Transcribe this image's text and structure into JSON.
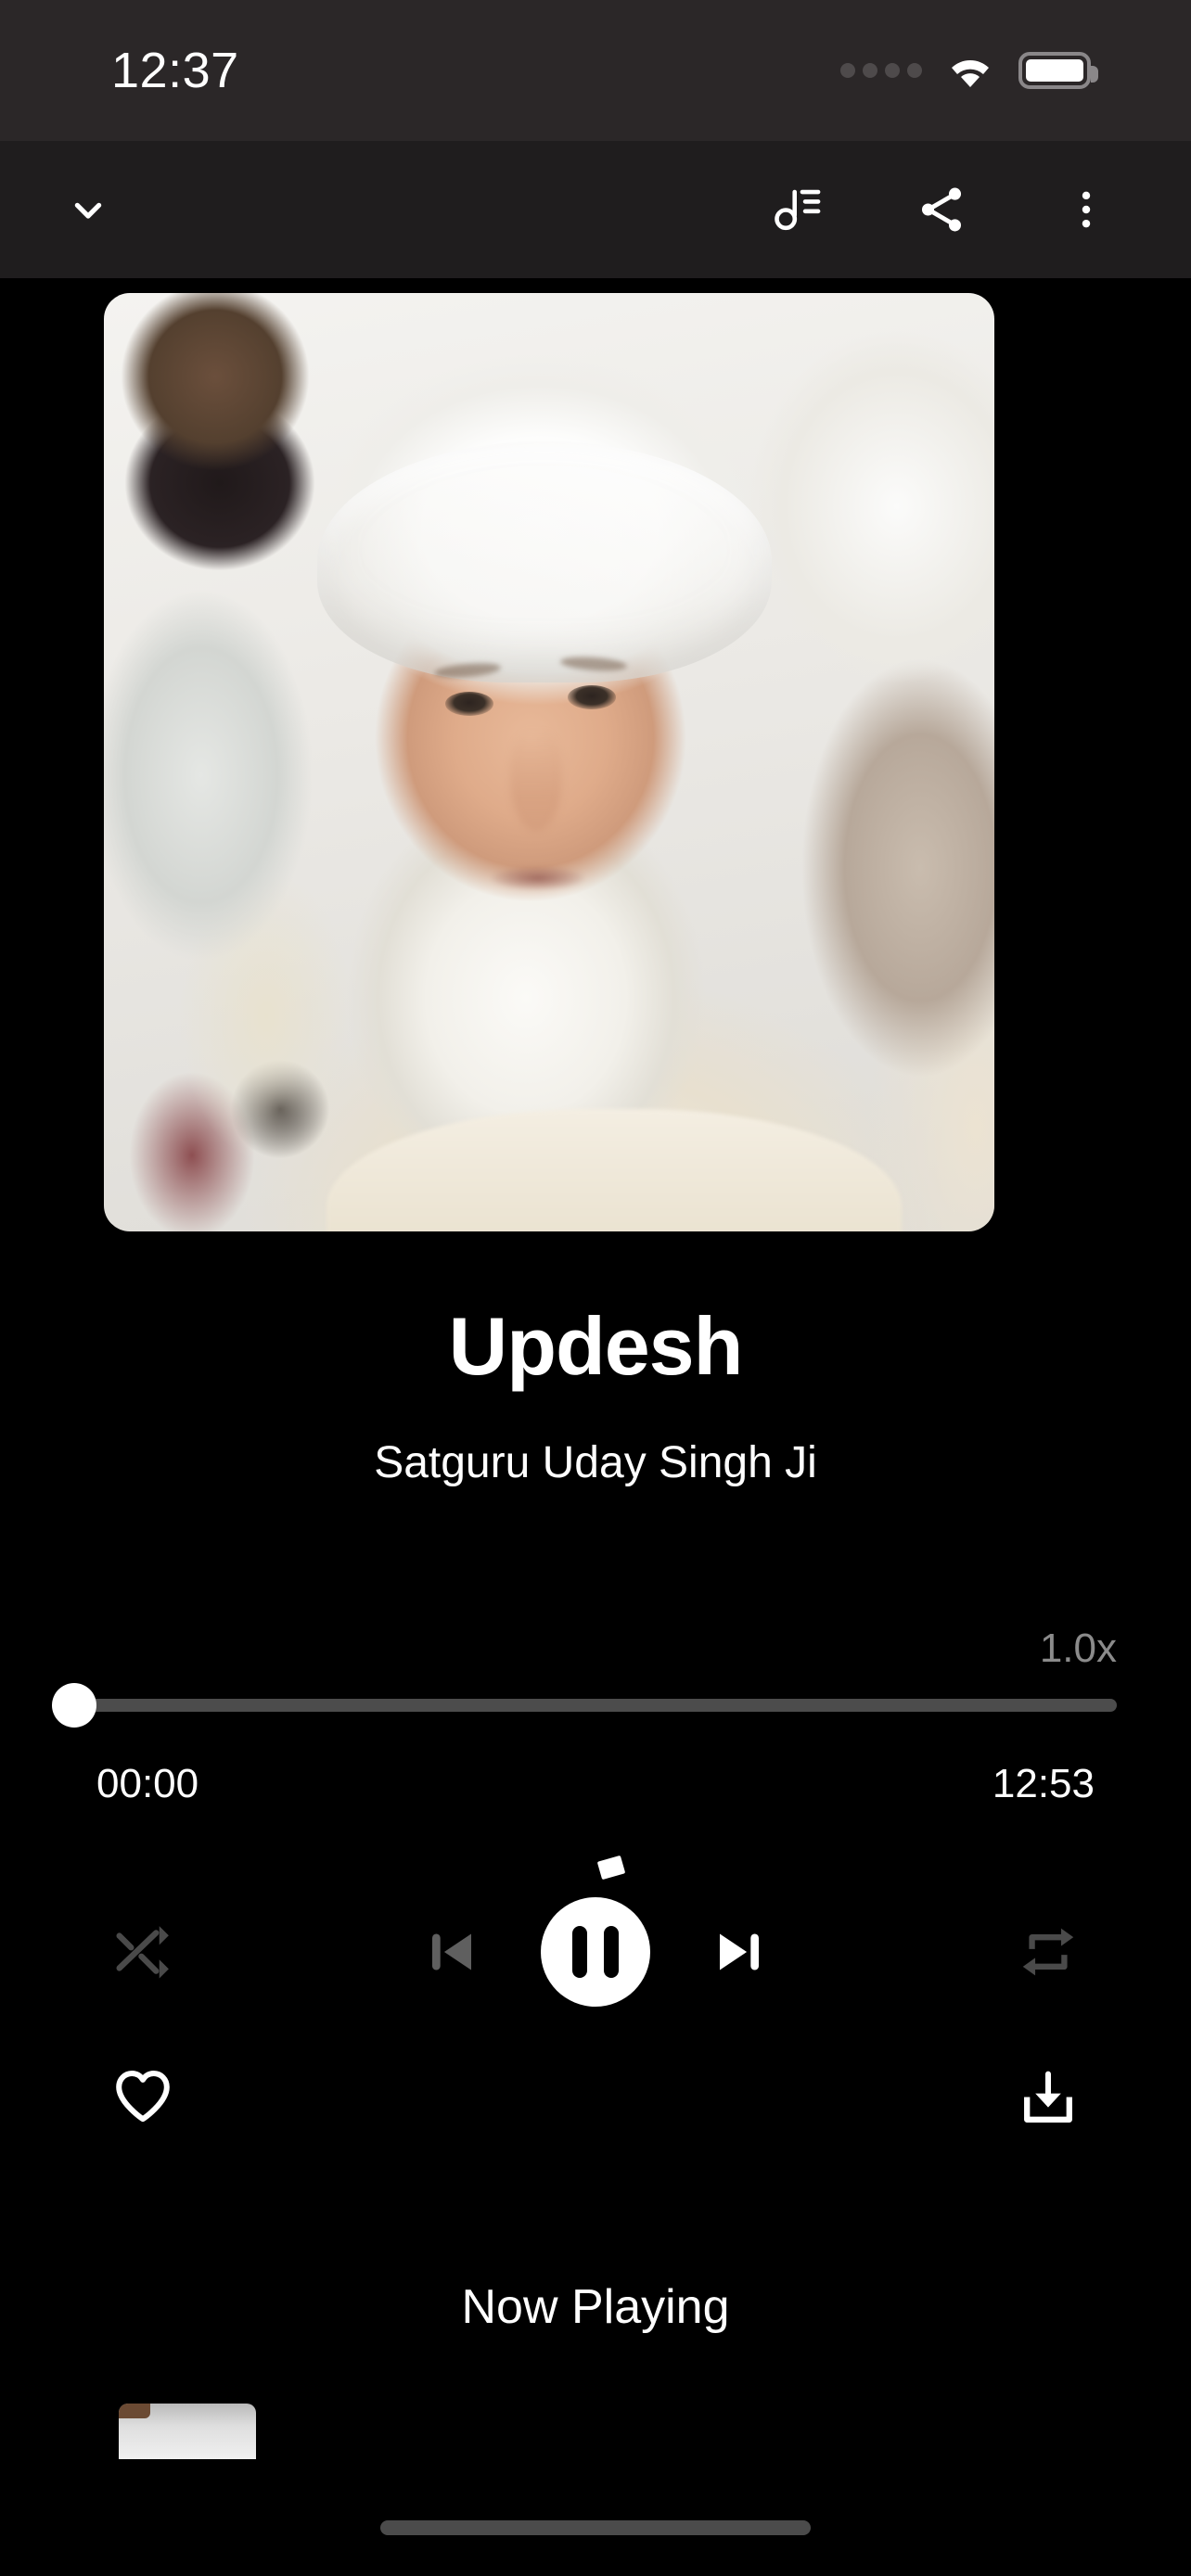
{
  "status_bar": {
    "time": "12:37",
    "icons": {
      "signal": "signal-dots-icon",
      "wifi": "wifi-icon",
      "battery": "battery-full-icon"
    }
  },
  "toolbar": {
    "collapse": {
      "label": "",
      "icon": "chevron-down-icon"
    },
    "queue": {
      "label": "",
      "icon": "queue-music-icon"
    },
    "share": {
      "label": "",
      "icon": "share-icon"
    },
    "more": {
      "label": "",
      "icon": "more-vertical-icon"
    }
  },
  "artwork": {
    "alt": "Satguru Uday Singh Ji portrait"
  },
  "track": {
    "title": "Updesh",
    "artist": "Satguru Uday Singh Ji"
  },
  "player": {
    "speed": "1.0x",
    "progress_percent": 0,
    "elapsed": "00:00",
    "duration": "12:53",
    "controls": {
      "shuffle": {
        "icon": "shuffle-icon",
        "state": "off"
      },
      "previous": {
        "icon": "skip-previous-icon",
        "state": "disabled"
      },
      "play_pause": {
        "icon": "pause-icon",
        "state": "playing"
      },
      "next": {
        "icon": "skip-next-icon",
        "state": "enabled"
      },
      "repeat": {
        "icon": "repeat-icon",
        "state": "off"
      }
    }
  },
  "actions": {
    "favorite": {
      "icon": "heart-outline-icon",
      "state": "off"
    },
    "download": {
      "icon": "download-icon",
      "state": "off"
    }
  },
  "queue_section": {
    "heading": "Now Playing"
  },
  "colors": {
    "background": "#000000",
    "status_bar_bg": "#2b2728",
    "toolbar_bg": "#1f1d1e",
    "primary_text": "#ffffff",
    "muted_text": "#8b8b8b",
    "dim_icon": "#4a4a4a",
    "disabled_icon": "#5f5f5f",
    "track_bg": "#4c4c4c",
    "accent": "#ffffff",
    "home_indicator": "#4b4b4b"
  }
}
